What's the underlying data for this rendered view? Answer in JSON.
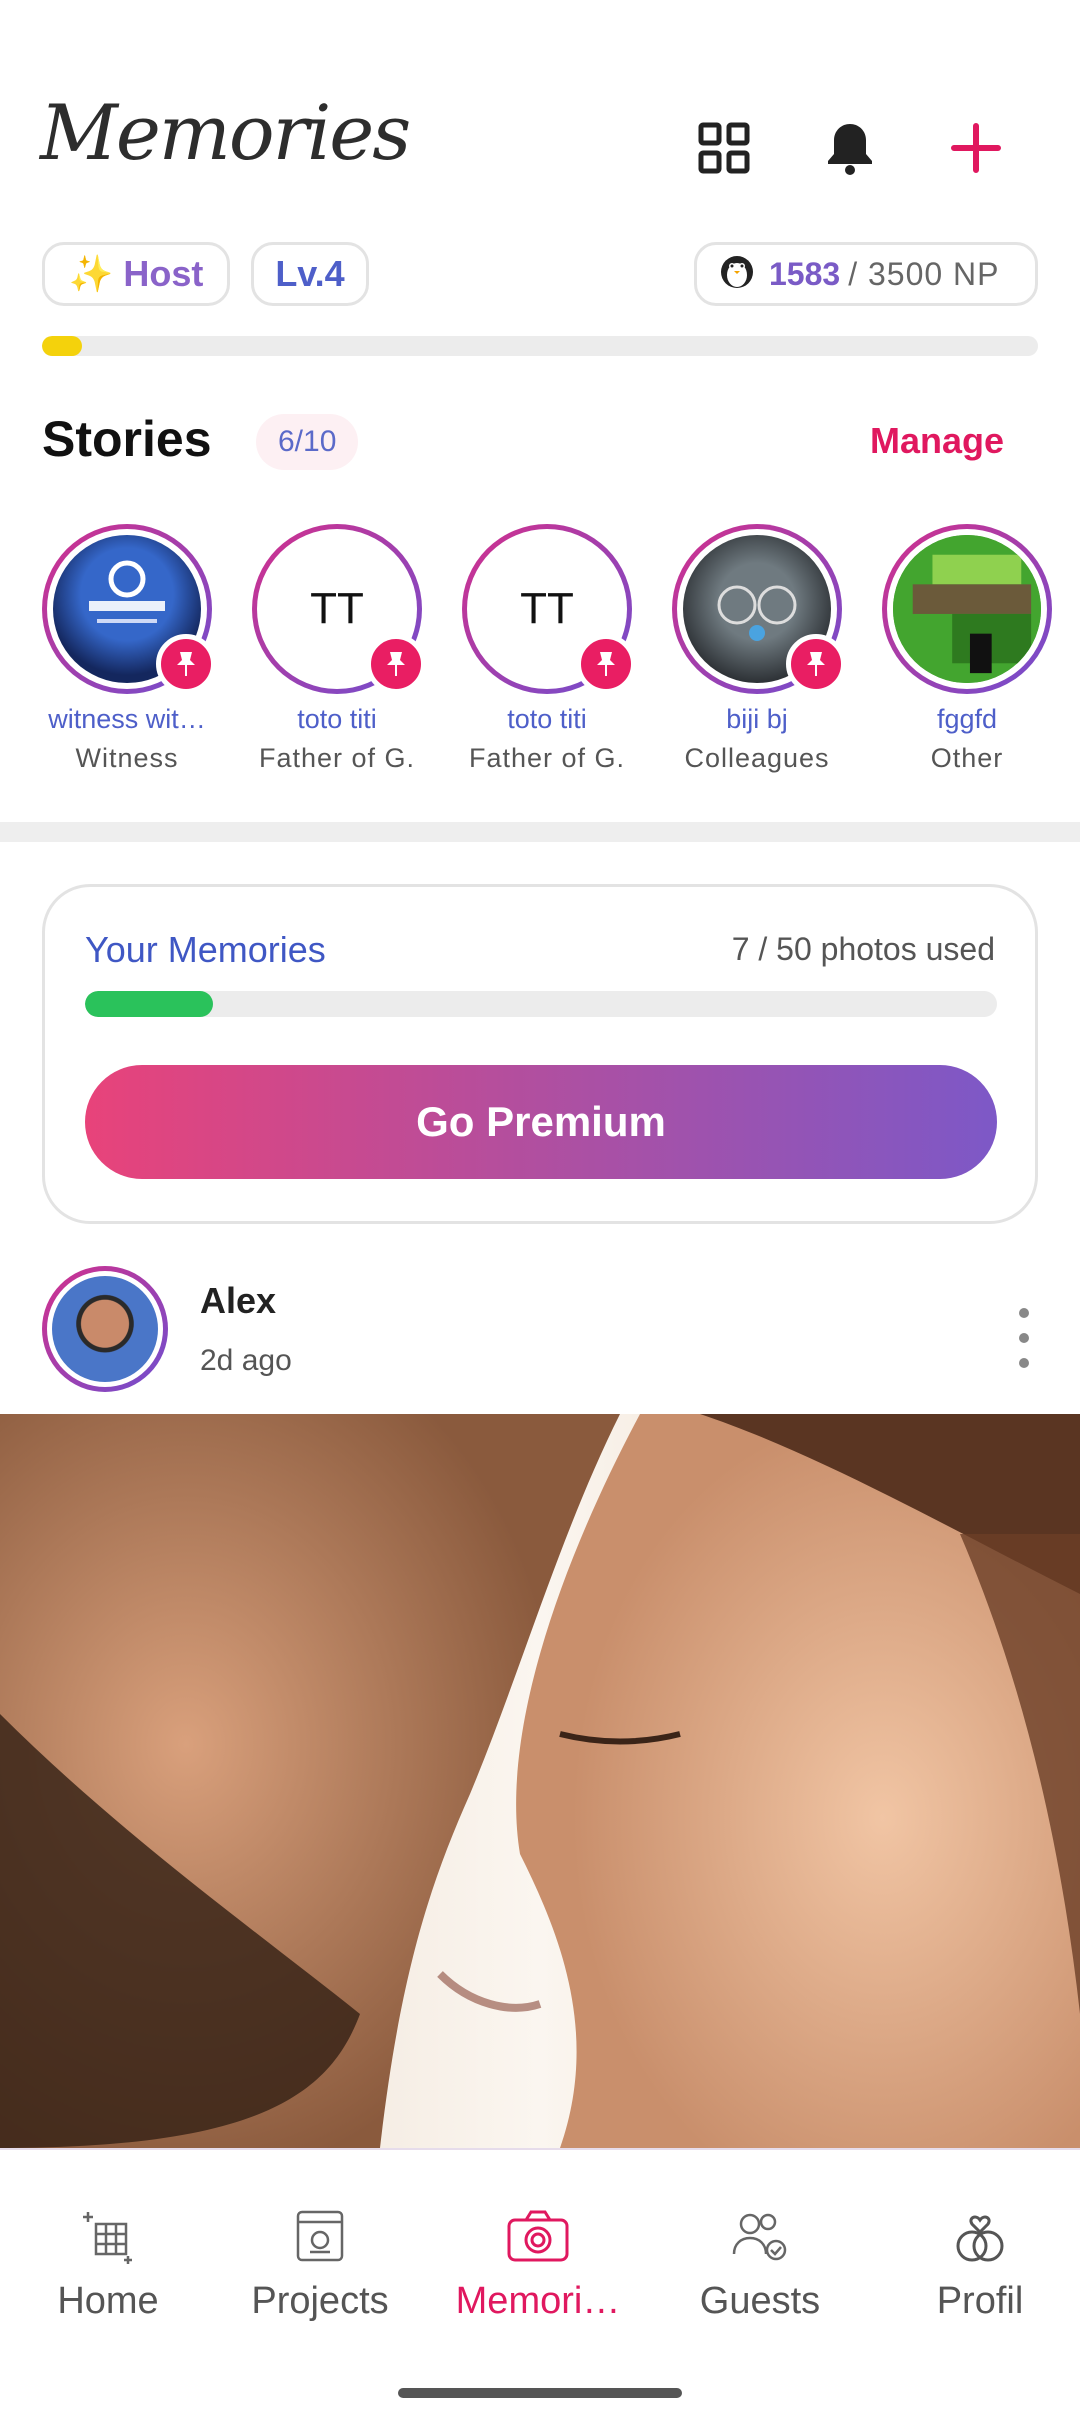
{
  "header": {
    "title": "Memories"
  },
  "status": {
    "role_badge": "✨ Host",
    "level_badge": "Lv.4",
    "np_current": "1583",
    "np_total": "/ 3500 NP",
    "xp_progress_fraction": 0.04
  },
  "stories": {
    "title": "Stories",
    "count": "6/10",
    "manage_label": "Manage",
    "items": [
      {
        "name": "witness wit…",
        "relation": "Witness",
        "initials": ""
      },
      {
        "name": "toto titi",
        "relation": "Father of G.",
        "initials": "TT"
      },
      {
        "name": "toto titi",
        "relation": "Father of G.",
        "initials": "TT"
      },
      {
        "name": "biji bj",
        "relation": "Colleagues",
        "initials": ""
      },
      {
        "name": "fggfd",
        "relation": "Other",
        "initials": ""
      }
    ]
  },
  "memories_card": {
    "title": "Your Memories",
    "usage": "7 / 50 photos used",
    "usage_fraction": 0.14,
    "premium_label": "Go Premium"
  },
  "post": {
    "author": "Alex",
    "time": "2d ago"
  },
  "bottom_nav": {
    "items": [
      {
        "label": "Home",
        "icon": "home-sparkle-icon"
      },
      {
        "label": "Projects",
        "icon": "projects-icon"
      },
      {
        "label": "Memori…",
        "icon": "camera-icon"
      },
      {
        "label": "Guests",
        "icon": "guests-icon"
      },
      {
        "label": "Profil",
        "icon": "rings-icon"
      }
    ],
    "active_index": 2
  },
  "colors": {
    "accent": "#e0185f",
    "blue": "#4e5fc9",
    "purple": "#7a5bc6",
    "xp_bar": "#f4d20c",
    "usage_bar": "#2ac25b"
  }
}
